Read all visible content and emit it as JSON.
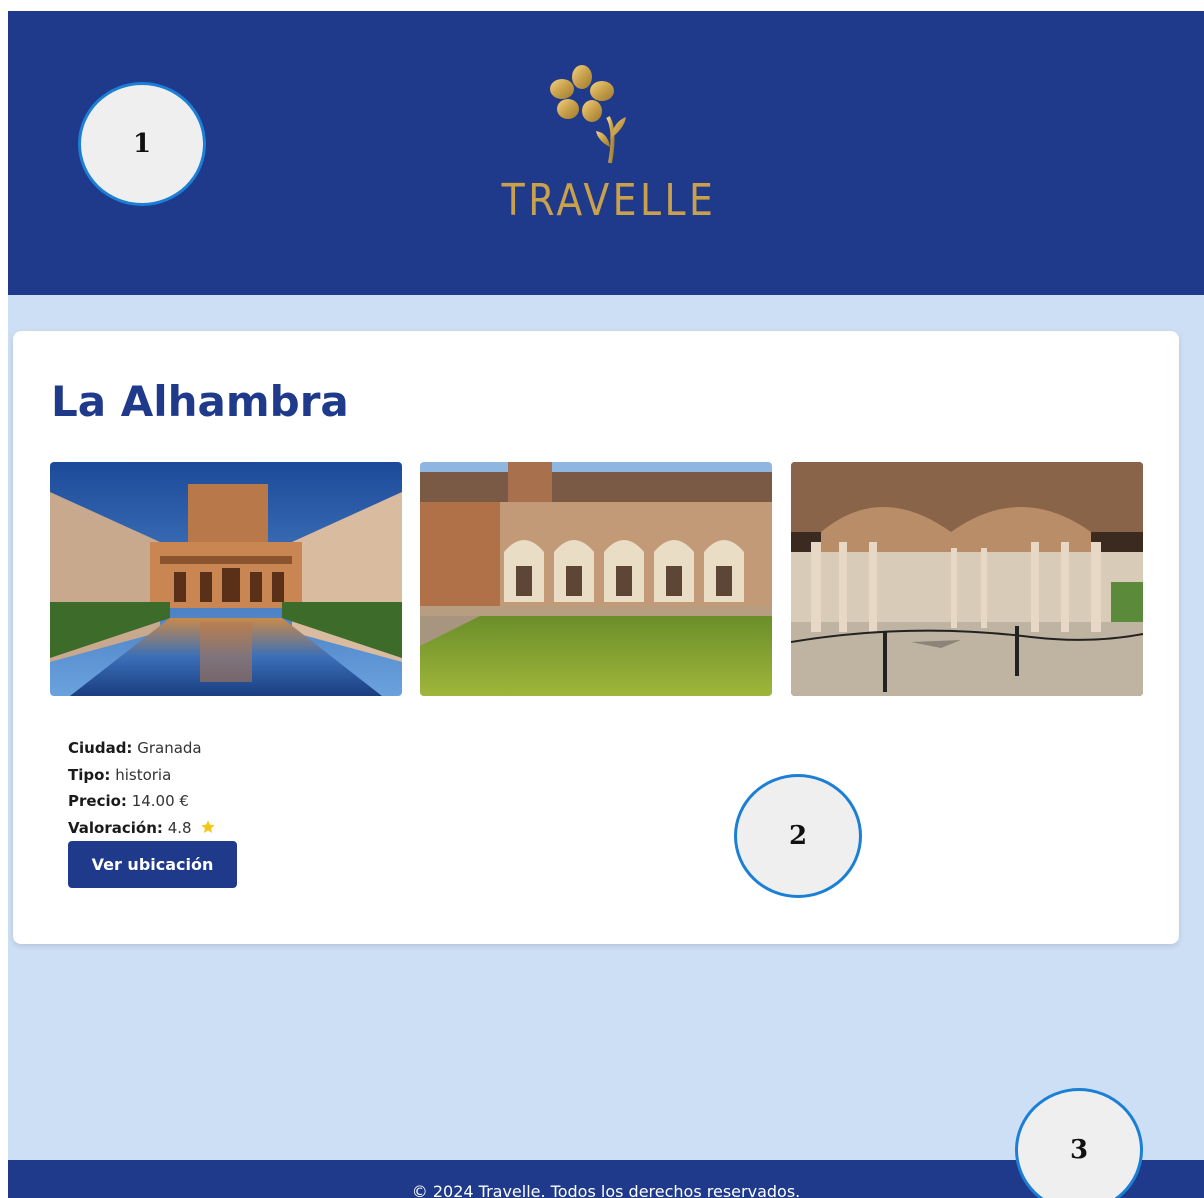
{
  "header": {
    "logo_text": "TRAVELLE"
  },
  "markers": [
    "1",
    "2",
    "3"
  ],
  "place": {
    "title": "La Alhambra",
    "details": {
      "city_label": "Ciudad:",
      "city_value": "Granada",
      "type_label": "Tipo:",
      "type_value": "historia",
      "price_label": "Precio:",
      "price_value": "14.00 €",
      "rating_label": "Valoración:",
      "rating_value": "4.8"
    },
    "button_label": "Ver ubicación"
  },
  "footer": {
    "text": "© 2024 Travelle. Todos los derechos reservados."
  },
  "icons": {
    "logo": "flower-logo-icon",
    "rating": "star-icon"
  },
  "colors": {
    "primary": "#1f3a8a",
    "background": "#cddff5",
    "gold": "#c9a04b",
    "star": "#f5c518",
    "marker_border": "#1c7fd6"
  }
}
